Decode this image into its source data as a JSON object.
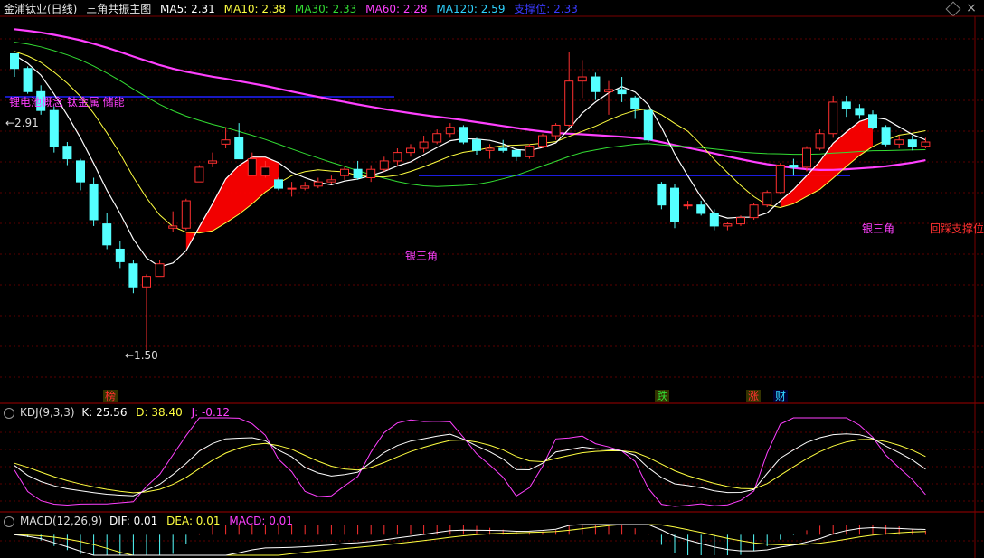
{
  "main_header": {
    "stock": "金浦钛业(日线)",
    "indicator": "三角共振主图",
    "ma5": "MA5: 2.31",
    "ma10": "MA10: 2.38",
    "ma30": "MA30: 2.33",
    "ma60": "MA60: 2.28",
    "ma120": "MA120: 2.59",
    "support": "支撑位: 2.33"
  },
  "kdj_header": {
    "name": "KDJ(9,3,3)",
    "k": "K: 25.56",
    "d": "D: 38.40",
    "j": "J: -0.12"
  },
  "macd_header": {
    "name": "MACD(12,26,9)",
    "dif": "DIF: 0.01",
    "dea": "DEA: 0.01",
    "macd": "MACD: 0.01"
  },
  "annotations": {
    "high_label": "2.91",
    "low_label": "1.50",
    "concept": "锂电池概念 钛金属 储能",
    "silver_triangle_1": "银三角",
    "silver_triangle_2": "银三角",
    "pullback": "回踩支撑位",
    "tag_bang": "榜",
    "tag_die": "跌",
    "tag_zhang": "涨",
    "tag_cai": "财"
  },
  "colors": {
    "up": "#ff3030",
    "down": "#54ffff",
    "ma5": "#ffffff",
    "ma10": "#ffff40",
    "ma30": "#33dd33",
    "ma60": "#ff40ff",
    "ma120": "#2fd3ff",
    "support": "#2020ff",
    "fill": "#ff0000"
  },
  "chart_data": {
    "type": "candlestick",
    "support_level": 2.33,
    "candles": [
      [
        2.91,
        2.91,
        2.8,
        2.84
      ],
      [
        2.84,
        2.85,
        2.72,
        2.73
      ],
      [
        2.73,
        2.76,
        2.62,
        2.64
      ],
      [
        2.64,
        2.66,
        2.44,
        2.47
      ],
      [
        2.47,
        2.49,
        2.38,
        2.41
      ],
      [
        2.4,
        2.41,
        2.26,
        2.3
      ],
      [
        2.29,
        2.32,
        2.09,
        2.12
      ],
      [
        2.1,
        2.15,
        1.98,
        2.0
      ],
      [
        1.98,
        2.02,
        1.89,
        1.92
      ],
      [
        1.91,
        1.93,
        1.77,
        1.8
      ],
      [
        1.8,
        1.86,
        1.5,
        1.85
      ],
      [
        1.85,
        1.93,
        1.85,
        1.91
      ],
      [
        2.08,
        2.16,
        2.06,
        2.09
      ],
      [
        2.08,
        2.22,
        2.07,
        2.21
      ],
      [
        2.3,
        2.38,
        2.3,
        2.37
      ],
      [
        2.39,
        2.44,
        2.37,
        2.4
      ],
      [
        2.48,
        2.56,
        2.46,
        2.5
      ],
      [
        2.51,
        2.58,
        2.46,
        2.41
      ],
      [
        2.33,
        2.44,
        2.33,
        2.41
      ],
      [
        2.33,
        2.4,
        2.32,
        2.37
      ],
      [
        2.31,
        2.32,
        2.26,
        2.27
      ],
      [
        2.27,
        2.3,
        2.23,
        2.27
      ],
      [
        2.27,
        2.3,
        2.26,
        2.28
      ],
      [
        2.28,
        2.32,
        2.27,
        2.3
      ],
      [
        2.3,
        2.33,
        2.29,
        2.31
      ],
      [
        2.33,
        2.37,
        2.31,
        2.36
      ],
      [
        2.36,
        2.4,
        2.31,
        2.32
      ],
      [
        2.32,
        2.38,
        2.3,
        2.36
      ],
      [
        2.36,
        2.42,
        2.35,
        2.4
      ],
      [
        2.4,
        2.46,
        2.38,
        2.44
      ],
      [
        2.44,
        2.48,
        2.42,
        2.46
      ],
      [
        2.46,
        2.52,
        2.44,
        2.49
      ],
      [
        2.49,
        2.55,
        2.48,
        2.53
      ],
      [
        2.53,
        2.58,
        2.51,
        2.56
      ],
      [
        2.56,
        2.57,
        2.48,
        2.49
      ],
      [
        2.5,
        2.51,
        2.43,
        2.45
      ],
      [
        2.45,
        2.48,
        2.41,
        2.46
      ],
      [
        2.46,
        2.5,
        2.44,
        2.45
      ],
      [
        2.45,
        2.46,
        2.4,
        2.42
      ],
      [
        2.42,
        2.48,
        2.41,
        2.47
      ],
      [
        2.47,
        2.53,
        2.46,
        2.52
      ],
      [
        2.52,
        2.58,
        2.5,
        2.57
      ],
      [
        2.57,
        2.92,
        2.56,
        2.78
      ],
      [
        2.78,
        2.88,
        2.7,
        2.8
      ],
      [
        2.8,
        2.82,
        2.69,
        2.73
      ],
      [
        2.73,
        2.78,
        2.62,
        2.74
      ],
      [
        2.74,
        2.8,
        2.68,
        2.72
      ],
      [
        2.7,
        2.71,
        2.6,
        2.65
      ],
      [
        2.64,
        2.65,
        2.49,
        2.5
      ],
      [
        2.29,
        2.3,
        2.17,
        2.19
      ],
      [
        2.27,
        2.29,
        2.08,
        2.11
      ],
      [
        2.19,
        2.21,
        2.17,
        2.19
      ],
      [
        2.19,
        2.21,
        2.14,
        2.15
      ],
      [
        2.15,
        2.17,
        2.07,
        2.09
      ],
      [
        2.09,
        2.11,
        2.07,
        2.1
      ],
      [
        2.1,
        2.14,
        2.09,
        2.13
      ],
      [
        2.13,
        2.2,
        2.12,
        2.19
      ],
      [
        2.19,
        2.26,
        2.18,
        2.25
      ],
      [
        2.25,
        2.39,
        2.24,
        2.38
      ],
      [
        2.38,
        2.41,
        2.33,
        2.37
      ],
      [
        2.37,
        2.47,
        2.35,
        2.46
      ],
      [
        2.46,
        2.55,
        2.45,
        2.53
      ],
      [
        2.53,
        2.71,
        2.51,
        2.68
      ],
      [
        2.68,
        2.71,
        2.61,
        2.65
      ],
      [
        2.65,
        2.67,
        2.6,
        2.62
      ],
      [
        2.62,
        2.64,
        2.55,
        2.56
      ],
      [
        2.56,
        2.57,
        2.47,
        2.48
      ],
      [
        2.48,
        2.52,
        2.46,
        2.5
      ],
      [
        2.5,
        2.52,
        2.45,
        2.47
      ],
      [
        2.47,
        2.51,
        2.46,
        2.49
      ]
    ],
    "ylim": [
      1.25,
      3.08
    ],
    "kdj_range": [
      -10,
      110
    ],
    "macd_range": [
      -0.12,
      0.06
    ]
  }
}
